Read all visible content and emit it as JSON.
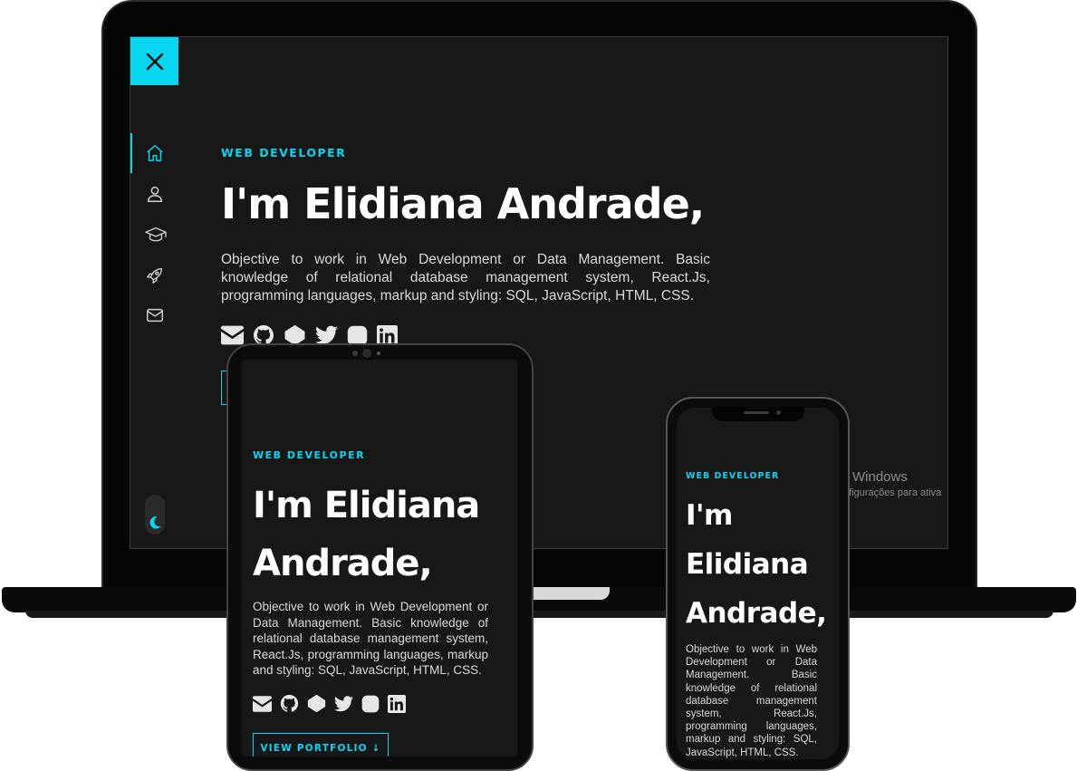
{
  "laptop": {
    "nav_items": [
      {
        "name": "home-icon"
      },
      {
        "name": "user-icon"
      },
      {
        "name": "graduation-cap-icon"
      },
      {
        "name": "rocket-icon"
      },
      {
        "name": "envelope-icon"
      }
    ],
    "subtitle": "WEB DEVELOPER",
    "heading": "I'm Elidiana Andrade,",
    "description": "Objective to work in Web Development or Data Management. Basic knowledge of relational database management system, React.Js, programming languages, markup and styling: SQL, JavaScript, HTML, CSS.",
    "windows_watermark_title": "Windows",
    "windows_watermark_sub": "nfigurações para ativa"
  },
  "tablet": {
    "subtitle": "WEB DEVELOPER",
    "heading_line1": "I'm Elidiana",
    "heading_line2": "Andrade,",
    "description": "Objective to work in Web Development or Data Management. Basic knowledge of relational database management system, React.Js, programming languages, markup and styling: SQL, JavaScript, HTML, CSS.",
    "portfolio_button": "VIEW PORTFOLIO ↓"
  },
  "phone": {
    "subtitle": "WEB DEVELOPER",
    "heading_line1": "I'm",
    "heading_line2": "Elidiana",
    "heading_line3": "Andrade,",
    "description": "Objective to work in Web Development or Data Management. Basic knowledge of relational database management system, React.Js, programming languages, markup and styling: SQL, JavaScript, HTML, CSS."
  },
  "social_icons": [
    "envelope-icon",
    "github-icon",
    "codepen-icon",
    "twitter-icon",
    "instagram-icon",
    "linkedin-icon"
  ],
  "colors": {
    "accent": "#07d6f0",
    "background": "#171717",
    "text": "#ffffff"
  }
}
